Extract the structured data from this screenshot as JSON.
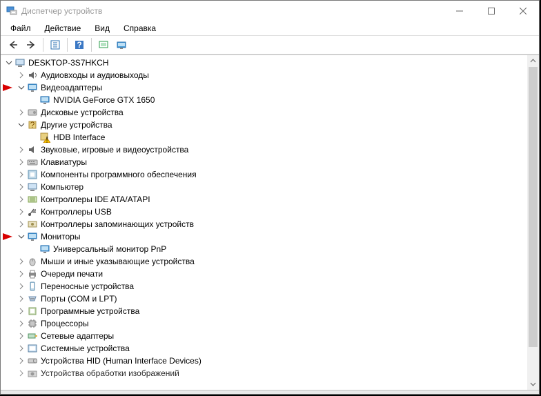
{
  "window": {
    "title": "Диспетчер устройств"
  },
  "menu": {
    "file": "Файл",
    "action": "Действие",
    "view": "Вид",
    "help": "Справка"
  },
  "tree": {
    "root": "DESKTOP-3S7HKCH",
    "audio": "Аудиовходы и аудиовыходы",
    "video_adapters": "Видеоадаптеры",
    "gpu": "NVIDIA GeForce GTX 1650",
    "disk": "Дисковые устройства",
    "other_devices": "Другие устройства",
    "hdb": "HDB Interface",
    "sound_game": "Звуковые, игровые и видеоустройства",
    "keyboards": "Клавиатуры",
    "software_components": "Компоненты программного обеспечения",
    "computer": "Компьютер",
    "ide": "Контроллеры IDE ATA/ATAPI",
    "usb": "Контроллеры USB",
    "storage_ctrl": "Контроллеры запоминающих устройств",
    "monitors": "Мониторы",
    "pnp_monitor": "Универсальный монитор PnP",
    "mice": "Мыши и иные указывающие устройства",
    "print_queues": "Очереди печати",
    "portable": "Переносные устройства",
    "ports": "Порты (COM и LPT)",
    "software_devices": "Программные устройства",
    "cpu": "Процессоры",
    "network": "Сетевые адаптеры",
    "system_devices": "Системные устройства",
    "hid": "Устройства HID (Human Interface Devices)",
    "image_proc": "Устройства обработки изображений"
  },
  "icons": {
    "chevron_right": "▶",
    "chevron_down": "▼"
  }
}
